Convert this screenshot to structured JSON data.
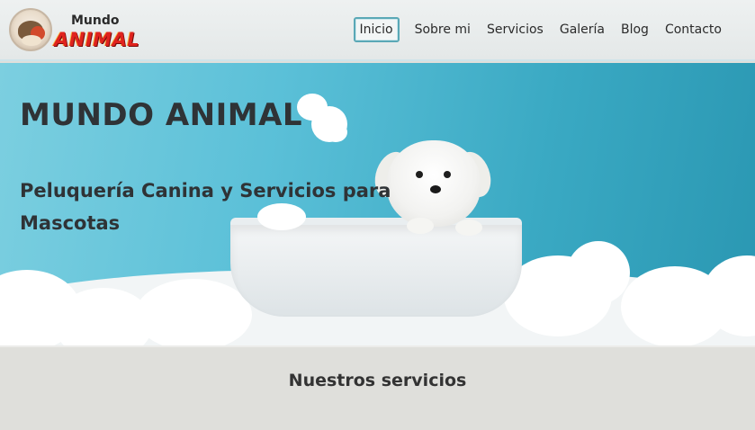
{
  "header": {
    "logo": {
      "top_text": "Mundo",
      "bottom_text": "ANIMAL"
    },
    "nav": [
      {
        "label": "Inicio",
        "active": true
      },
      {
        "label": "Sobre mi",
        "active": false
      },
      {
        "label": "Servicios",
        "active": false
      },
      {
        "label": "Galería",
        "active": false
      },
      {
        "label": "Blog",
        "active": false
      },
      {
        "label": "Contacto",
        "active": false
      }
    ]
  },
  "hero": {
    "title": "MUNDO ANIMAL",
    "subtitle": "Peluquería Canina y Servicios para Mascotas"
  },
  "services": {
    "title": "Nuestros servicios"
  },
  "colors": {
    "accent": "#5aa8b6",
    "hero_blue": "#3aa9c3",
    "logo_red": "#e0231e"
  }
}
